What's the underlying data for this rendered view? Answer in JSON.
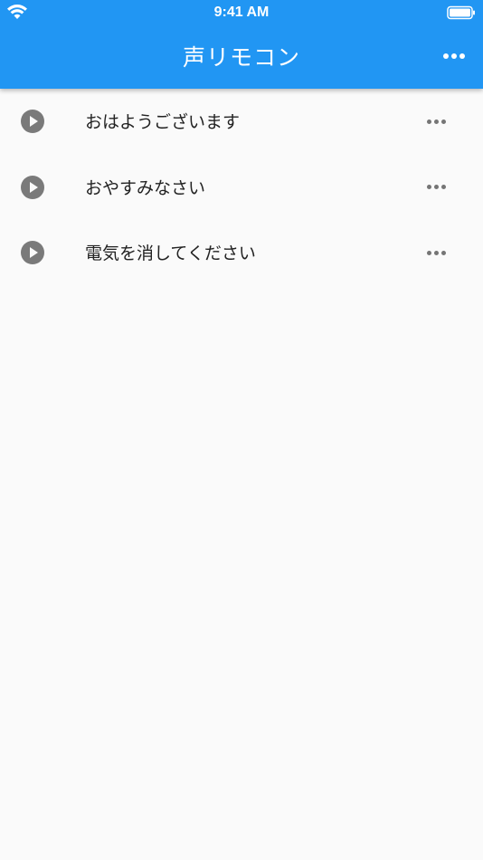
{
  "status_bar": {
    "time": "9:41 AM"
  },
  "header": {
    "title": "声リモコン"
  },
  "items": [
    {
      "label": "おはようございます"
    },
    {
      "label": "おやすみなさい"
    },
    {
      "label": "電気を消してください"
    }
  ],
  "colors": {
    "primary": "#2196f3",
    "background": "#fafafa",
    "icon": "#7a7a7a"
  }
}
